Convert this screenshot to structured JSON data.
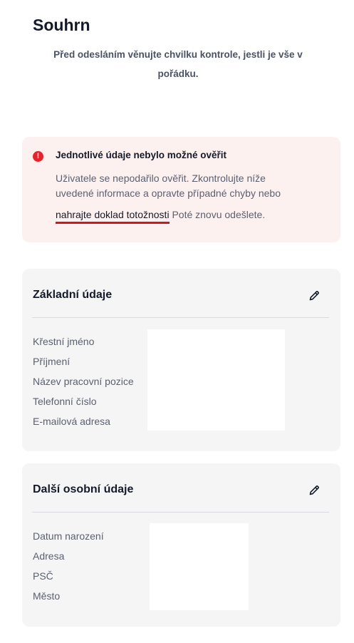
{
  "header": {
    "title": "Souhrn",
    "subtitle": "Před odesláním věnujte chvilku kontrole, jestli je vše v pořádku."
  },
  "alert": {
    "icon": "error-icon",
    "icon_glyph": "!",
    "title": "Jednotlivé údaje nebylo možné ověřit",
    "body": "Uživatele se nepodařilo ověřit. Zkontrolujte níže uvedené informace a opravte případné chyby nebo",
    "link_label": "nahrajte doklad totožnosti",
    "after_link": " Poté znovu odešlete.",
    "accent_color": "#d4141e"
  },
  "basic_info": {
    "title": "Základní údaje",
    "edit_icon": "pencil-icon",
    "fields": [
      "Křestní jméno",
      "Příjmení",
      "Název pracovní pozice",
      "Telefonní číslo",
      "E-mailová adresa"
    ]
  },
  "personal_info": {
    "title": "Další osobní údaje",
    "edit_icon": "pencil-icon",
    "fields": [
      "Datum narození",
      "Adresa",
      "PSČ",
      "Město"
    ]
  }
}
